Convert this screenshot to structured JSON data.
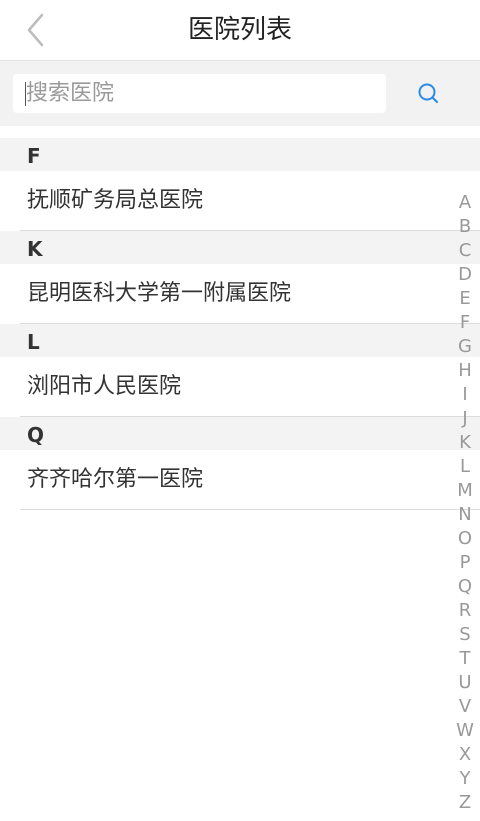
{
  "header": {
    "title": "医院列表"
  },
  "search": {
    "placeholder": "搜索医院"
  },
  "sections": [
    {
      "letter": "F",
      "items": [
        "抚顺矿务局总医院"
      ]
    },
    {
      "letter": "K",
      "items": [
        "昆明医科大学第一附属医院"
      ]
    },
    {
      "letter": "L",
      "items": [
        "浏阳市人民医院"
      ]
    },
    {
      "letter": "Q",
      "items": [
        "齐齐哈尔第一医院"
      ]
    }
  ],
  "index_letters": [
    "A",
    "B",
    "C",
    "D",
    "E",
    "F",
    "G",
    "H",
    "I",
    "J",
    "K",
    "L",
    "M",
    "N",
    "O",
    "P",
    "Q",
    "R",
    "S",
    "T",
    "U",
    "V",
    "W",
    "X",
    "Y",
    "Z"
  ],
  "colors": {
    "accent": "#2a8be6",
    "back_arrow": "#bdbdbd"
  },
  "icons": {
    "back": "chevron-left-icon",
    "search": "search-icon"
  }
}
